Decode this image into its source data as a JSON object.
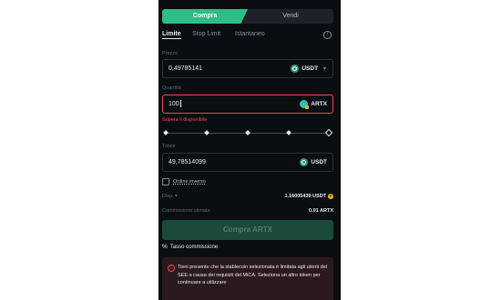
{
  "side_toggle": {
    "buy": "Compra",
    "sell": "Vendi"
  },
  "order_tabs": [
    "Limite",
    "Stop Limit",
    "Istantaneo"
  ],
  "price": {
    "label": "Prezzo",
    "value": "0,49785141",
    "unit": "USDT"
  },
  "quantity": {
    "label": "Quantità",
    "value": "100",
    "unit": "ARTX",
    "error": "Supera il disponibile"
  },
  "total": {
    "label": "Totale",
    "value": "49,78514099",
    "unit": "USDT"
  },
  "reverse_order": {
    "label": "Ordine inverso",
    "checked": false
  },
  "available": {
    "label": "Disp.",
    "value": "1.16005439 USDT"
  },
  "estimated_fee": {
    "label": "Commissione stimata",
    "value": "0.01 ARTX"
  },
  "buy_button": "Compra ARTX",
  "fee_rate_link": "Tasso commissione",
  "notice": {
    "text": "Tieni presente che la stablecoin selezionata è limitata agli utenti del SEE a causa dei requisiti del MiCA. Seleziona un altro token per continuare a utilizzare"
  },
  "colors": {
    "buy_green": "#2ebd85",
    "error_red": "#f6465d",
    "accent_yellow": "#f0b90b",
    "panel_bg": "#0b0e11"
  }
}
